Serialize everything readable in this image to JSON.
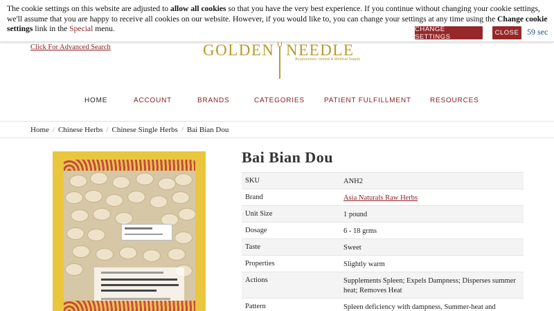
{
  "cookie": {
    "text_1": "The cookie settings on this website are adjusted to ",
    "bold_1": "allow all cookies",
    "text_2": " so that you have the very best experience. If you continue without changing your cookie settings, we'll assume that you are happy to receive all cookies on our website. However, if you would like to, you can change your settings at any time using the ",
    "bold_2": "Change cookie settings",
    "text_3": " link in the ",
    "special_link": "Special",
    "text_4": " menu.",
    "change_button": "Change settings",
    "close_button": "Close",
    "timer": "59 sec"
  },
  "header": {
    "advanced_search": "Click For Advanced Search",
    "logo_word_1": "GOLDEN",
    "logo_word_2": "NEEDLE",
    "logo_tagline": "Acupuncture, Herbal & Medical Supply"
  },
  "nav": {
    "items": [
      {
        "label": "Home",
        "active": true
      },
      {
        "label": "Account"
      },
      {
        "label": "Brands"
      },
      {
        "label": "Categories"
      },
      {
        "label": "Patient Fulfillment"
      },
      {
        "label": "Resources"
      }
    ]
  },
  "breadcrumb": [
    "Home",
    "Chinese Herbs",
    "Chinese Single Herbs",
    "Bai Bian Dou"
  ],
  "product": {
    "title": "Bai Bian Dou",
    "specs": [
      {
        "label": "SKU",
        "value": "ANH2"
      },
      {
        "label": "Brand",
        "value": "Asia Naturals Raw Herbs",
        "link": true
      },
      {
        "label": "Unit Size",
        "value": "1 pound"
      },
      {
        "label": "Dosage",
        "value": "6 - 18 grms"
      },
      {
        "label": "Taste",
        "value": "Sweet"
      },
      {
        "label": "Properties",
        "value": "Slightly warm"
      },
      {
        "label": "Actions",
        "value": "Supplements Spleen; Expels Dampness; Disperses summer heat; Removes Heat"
      },
      {
        "label": "Pattern",
        "value": "Spleen deficiency with dampness, Summer-heat and"
      }
    ]
  },
  "colors": {
    "accent": "#96282a",
    "link": "#8a1c1c",
    "logo_gold": "#b89a2c",
    "package_yellow": "#e9c63d"
  }
}
